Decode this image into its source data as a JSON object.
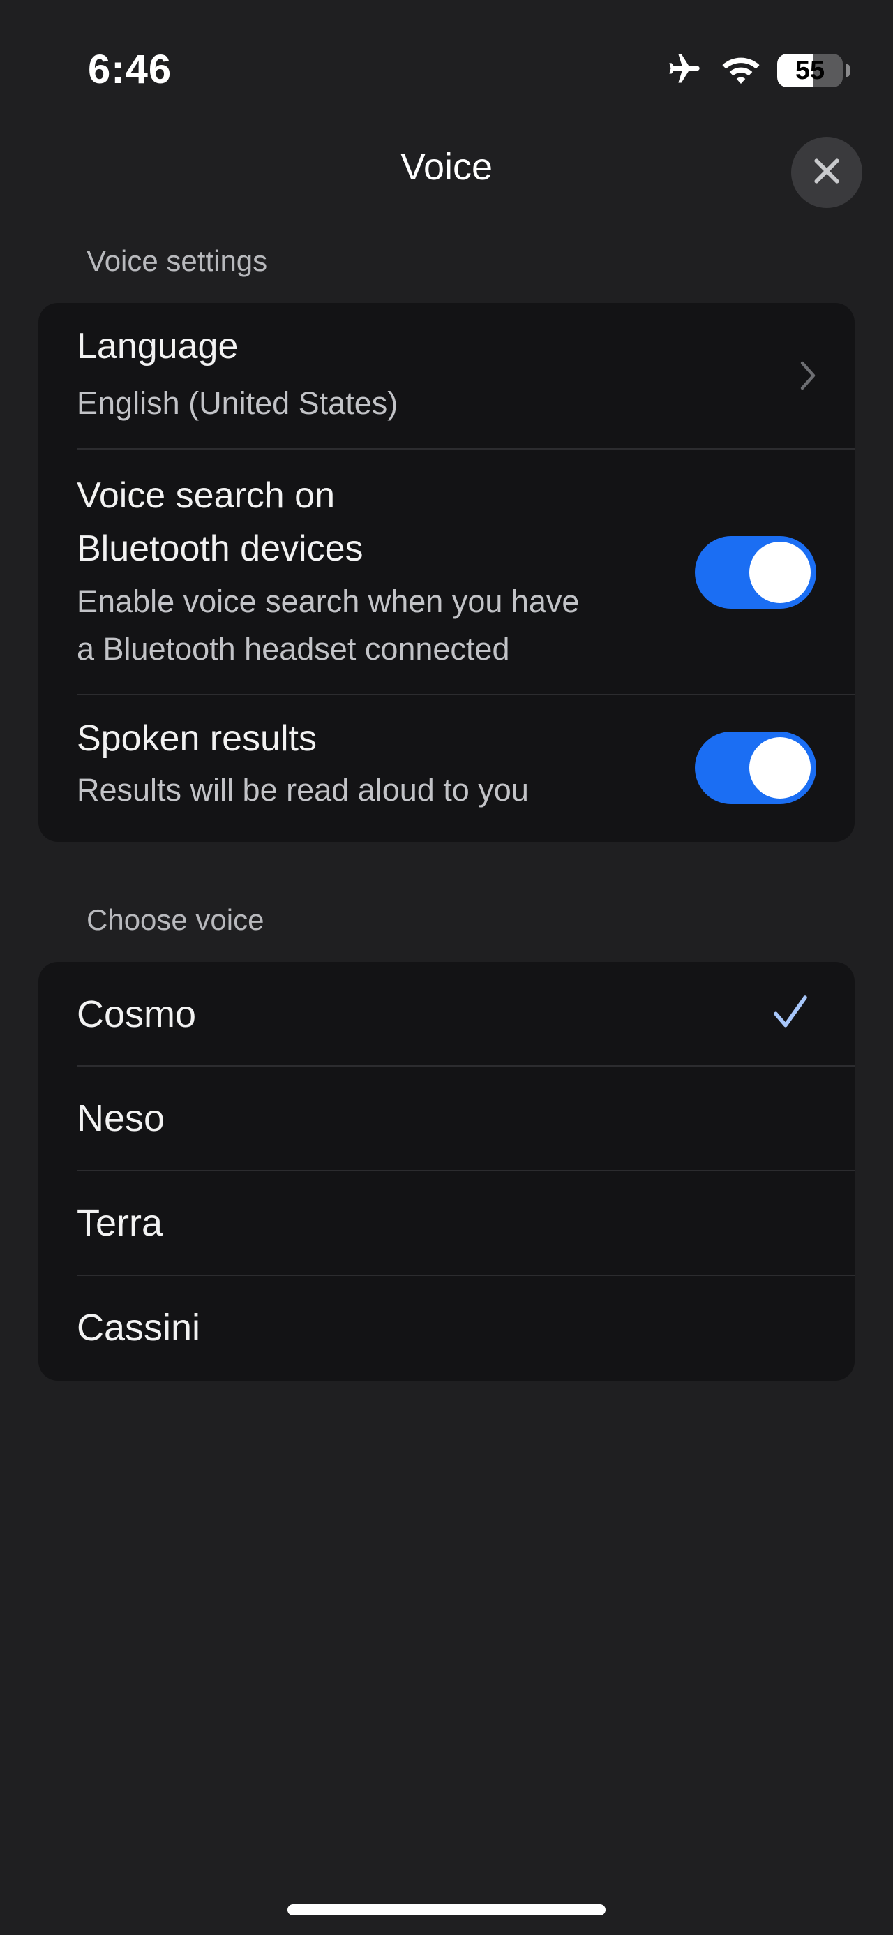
{
  "status_bar": {
    "time": "6:46",
    "battery_level": "55",
    "battery_fraction": 0.55,
    "icons": [
      "airplane-icon",
      "wifi-icon",
      "battery-icon"
    ]
  },
  "header": {
    "title": "Voice",
    "close_icon": "close-icon"
  },
  "voice_settings": {
    "section_title": "Voice settings",
    "language": {
      "title": "Language",
      "value": "English (United States)"
    },
    "bluetooth": {
      "title_line1": "Voice search on",
      "title_line2": "Bluetooth devices",
      "sub_line1": "Enable voice search when you have",
      "sub_line2": "a Bluetooth headset connected",
      "enabled": true
    },
    "spoken_results": {
      "title": "Spoken results",
      "sub": "Results will be read aloud to you",
      "enabled": true
    }
  },
  "choose_voice": {
    "section_title": "Choose voice",
    "voices": [
      "Cosmo",
      "Neso",
      "Terra",
      "Cassini"
    ],
    "selected": "Cosmo"
  },
  "colors": {
    "background": "#1f1f21",
    "card": "#131315",
    "toggle_on": "#1b6ef3",
    "check": "#a8c7fa"
  }
}
